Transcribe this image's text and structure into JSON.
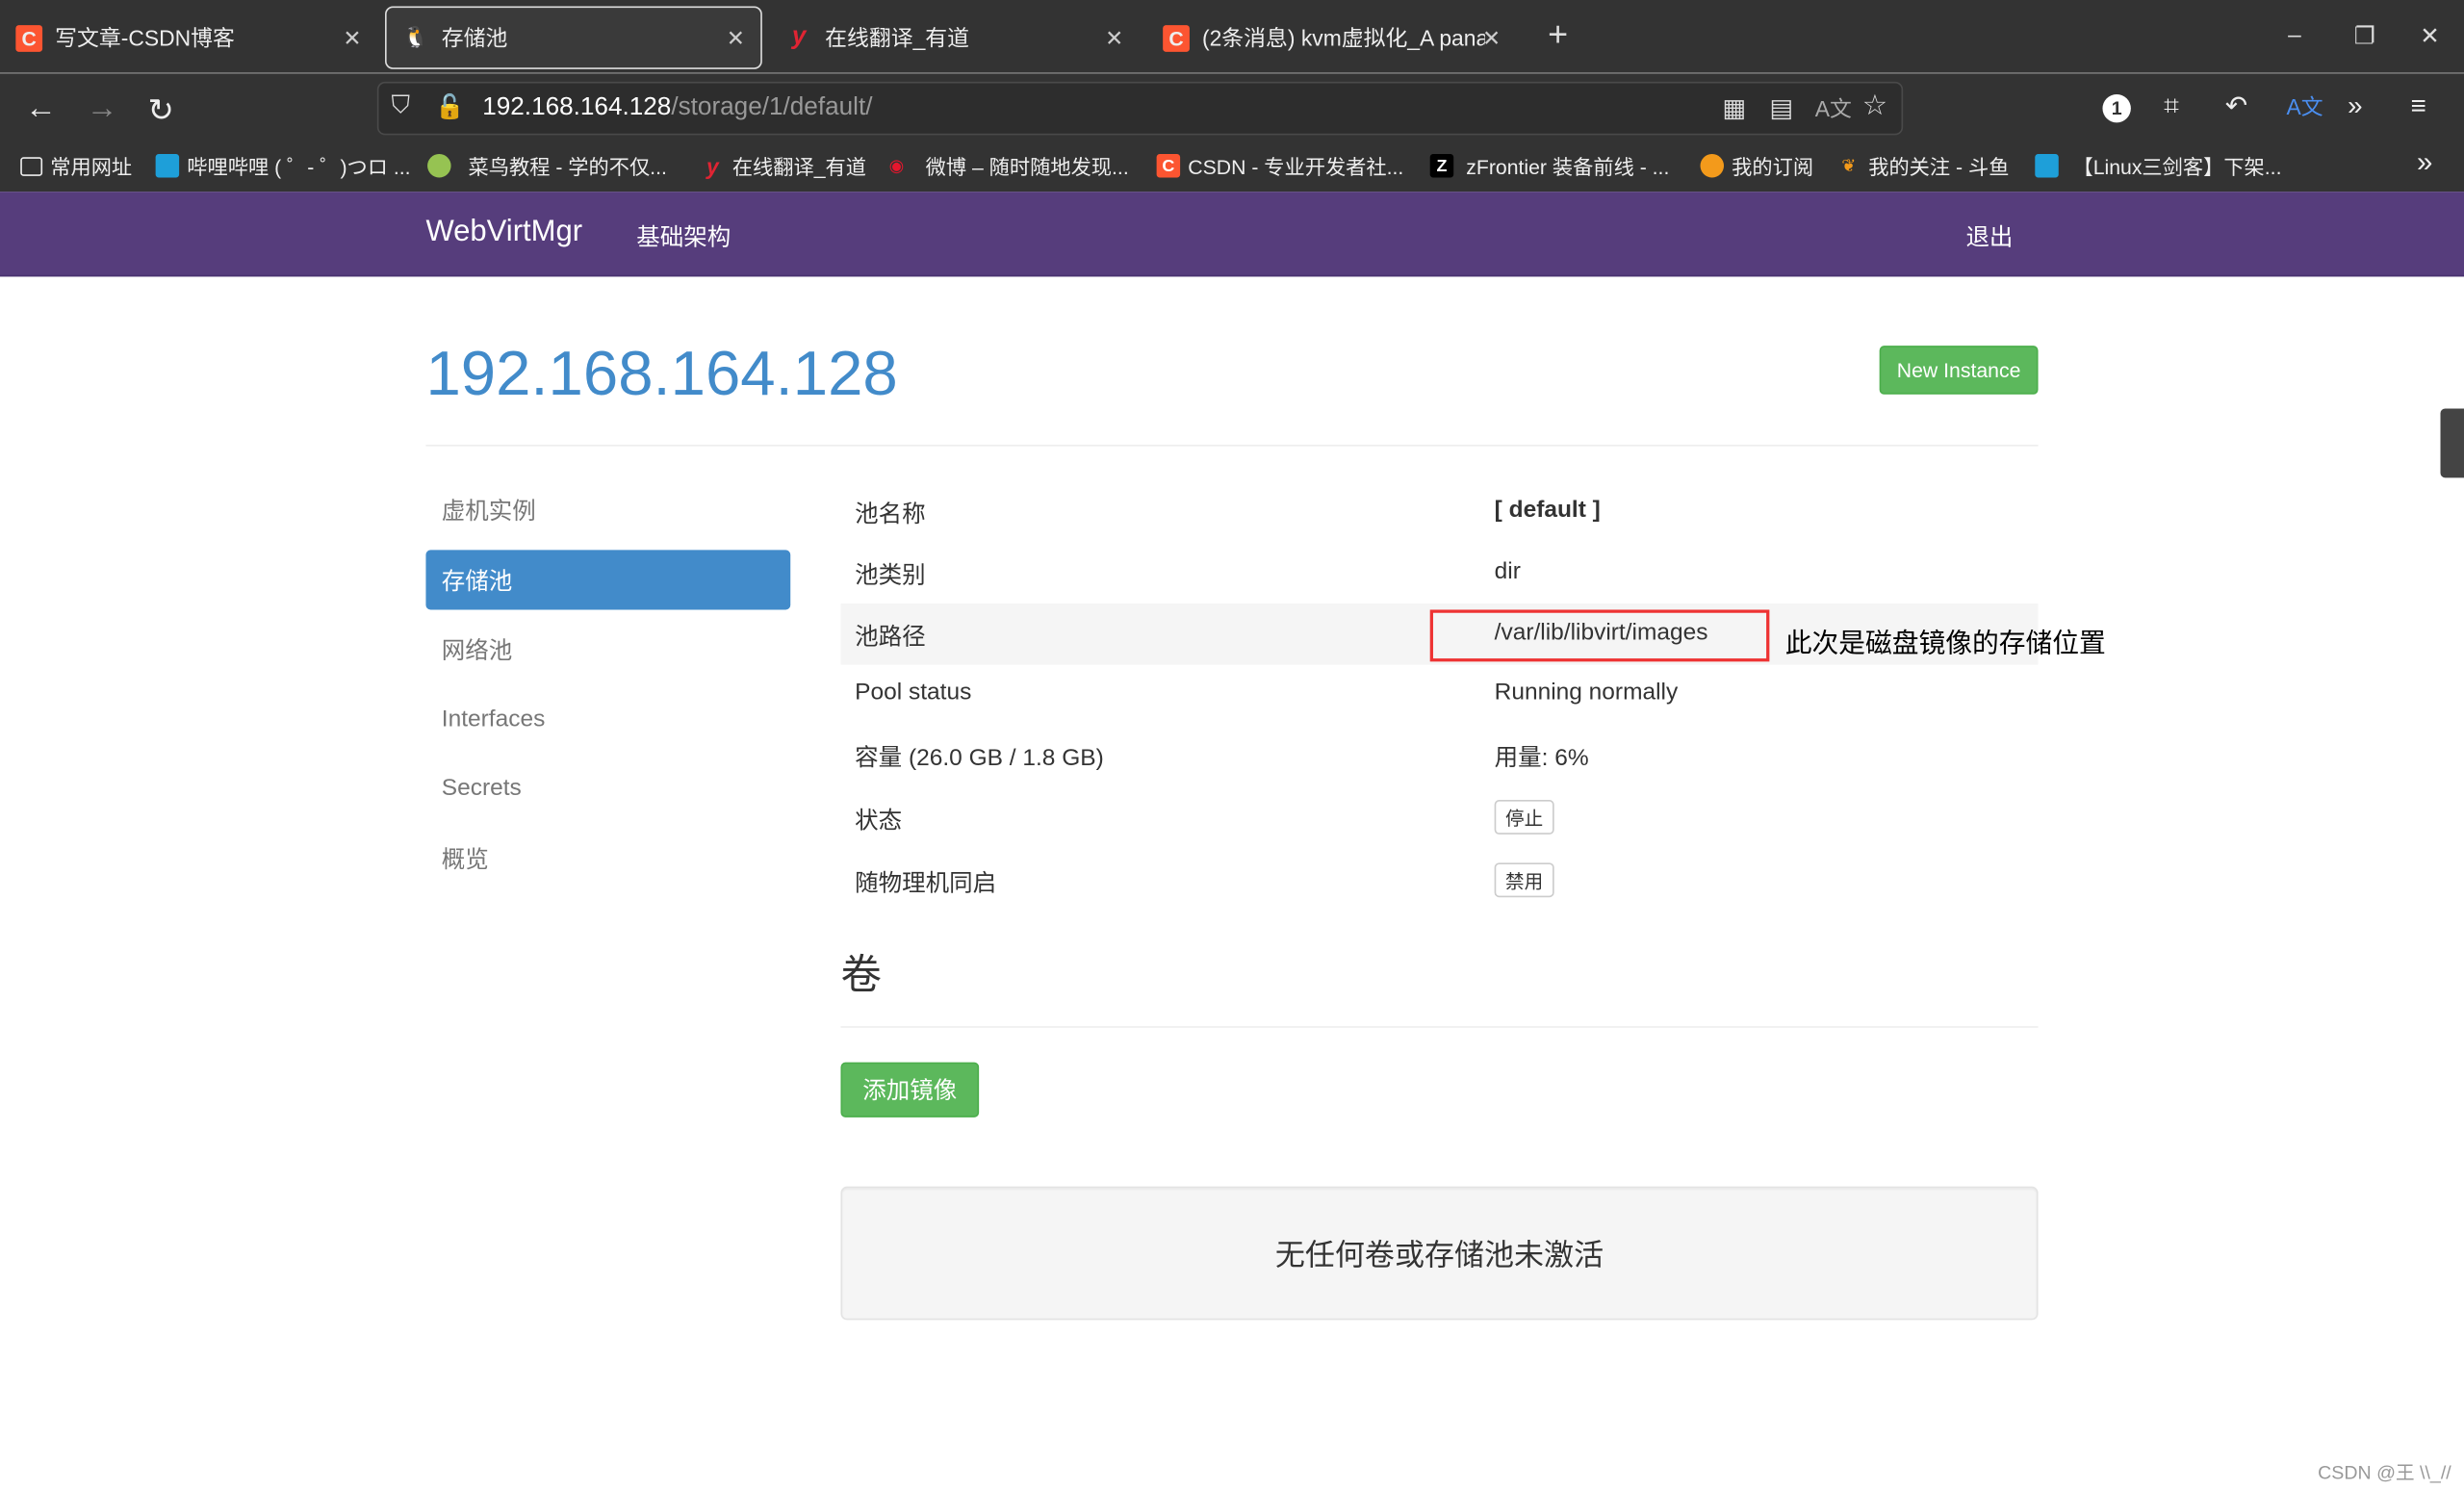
{
  "browser": {
    "tabs": [
      {
        "title": "写文章-CSDN博客",
        "icon": "csdn-icon",
        "active": false
      },
      {
        "title": "存储池",
        "icon": "linux-penguin-icon",
        "active": true
      },
      {
        "title": "在线翻译_有道",
        "icon": "youdao-icon",
        "active": false
      },
      {
        "title": "(2条消息) kvm虚拟化_A panac",
        "icon": "csdn-icon",
        "active": false
      }
    ],
    "url_host": "192.168.164.128",
    "url_path": "/storage/1/default/",
    "bookmarks": [
      {
        "label": "常用网址",
        "icon": "folder-icon"
      },
      {
        "label": "哔哩哔哩 ( ゜- ゜)つロ ...",
        "icon": "bilibili-icon"
      },
      {
        "label": "菜鸟教程 - 学的不仅...",
        "icon": "runoob-icon"
      },
      {
        "label": "在线翻译_有道",
        "icon": "youdao-icon"
      },
      {
        "label": "微博 – 随时随地发现...",
        "icon": "weibo-icon"
      },
      {
        "label": "CSDN - 专业开发者社...",
        "icon": "csdn-icon"
      },
      {
        "label": "zFrontier 装备前线 - ...",
        "icon": "zfrontier-icon"
      },
      {
        "label": "我的订阅",
        "icon": "subscription-icon"
      },
      {
        "label": "我的关注 - 斗鱼",
        "icon": "douyu-icon"
      },
      {
        "label": "【Linux三剑客】下架...",
        "icon": "bilibili-icon"
      }
    ]
  },
  "navbar": {
    "brand": "WebVirtMgr",
    "infrastructure": "基础架构",
    "logout": "退出"
  },
  "page": {
    "host_title": "192.168.164.128",
    "new_instance": "New Instance",
    "sidebar": [
      {
        "label": "虚机实例",
        "active": false
      },
      {
        "label": "存储池",
        "active": true
      },
      {
        "label": "网络池",
        "active": false
      },
      {
        "label": "Interfaces",
        "active": false
      },
      {
        "label": "Secrets",
        "active": false
      },
      {
        "label": "概览",
        "active": false
      }
    ],
    "pool": {
      "name_label": "池名称",
      "name_value": "[ default ]",
      "type_label": "池类别",
      "type_value": "dir",
      "path_label": "池路径",
      "path_value": "/var/lib/libvirt/images",
      "status_label": "Pool status",
      "status_value": "Running normally",
      "capacity_label": "容量 (26.0 GB / 1.8 GB)",
      "usage_value": "用量: 6%",
      "state_label": "状态",
      "stop_button": "停止",
      "autostart_label": "随物理机同启",
      "disable_button": "禁用"
    },
    "annotation": "此次是磁盘镜像的存储位置",
    "volumes_heading": "卷",
    "add_image_button": "添加镜像",
    "empty_message": "无任何卷或存储池未激活"
  },
  "watermark": "CSDN @王 \\\\_//",
  "colors": {
    "navbar": "#563d7c",
    "primary": "#428bca",
    "success": "#5cb85c",
    "highlight_box": "#ee3333"
  }
}
